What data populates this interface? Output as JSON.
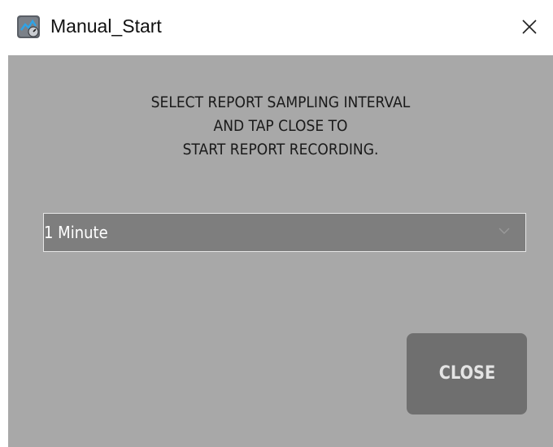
{
  "window": {
    "title": "Manual_Start",
    "icon": "app-gauge-icon",
    "close_icon": "close-icon"
  },
  "dialog": {
    "instructions": [
      "SELECT REPORT SAMPLING INTERVAL",
      "AND TAP CLOSE TO",
      "START REPORT RECORDING."
    ],
    "interval_select": {
      "selected": "1 Minute",
      "icon": "chevron-down-icon"
    },
    "close_button_label": "CLOSE"
  },
  "colors": {
    "background": "#a8a8a8",
    "dropdown": "#7e7e7e",
    "button": "#6f6f6f"
  }
}
